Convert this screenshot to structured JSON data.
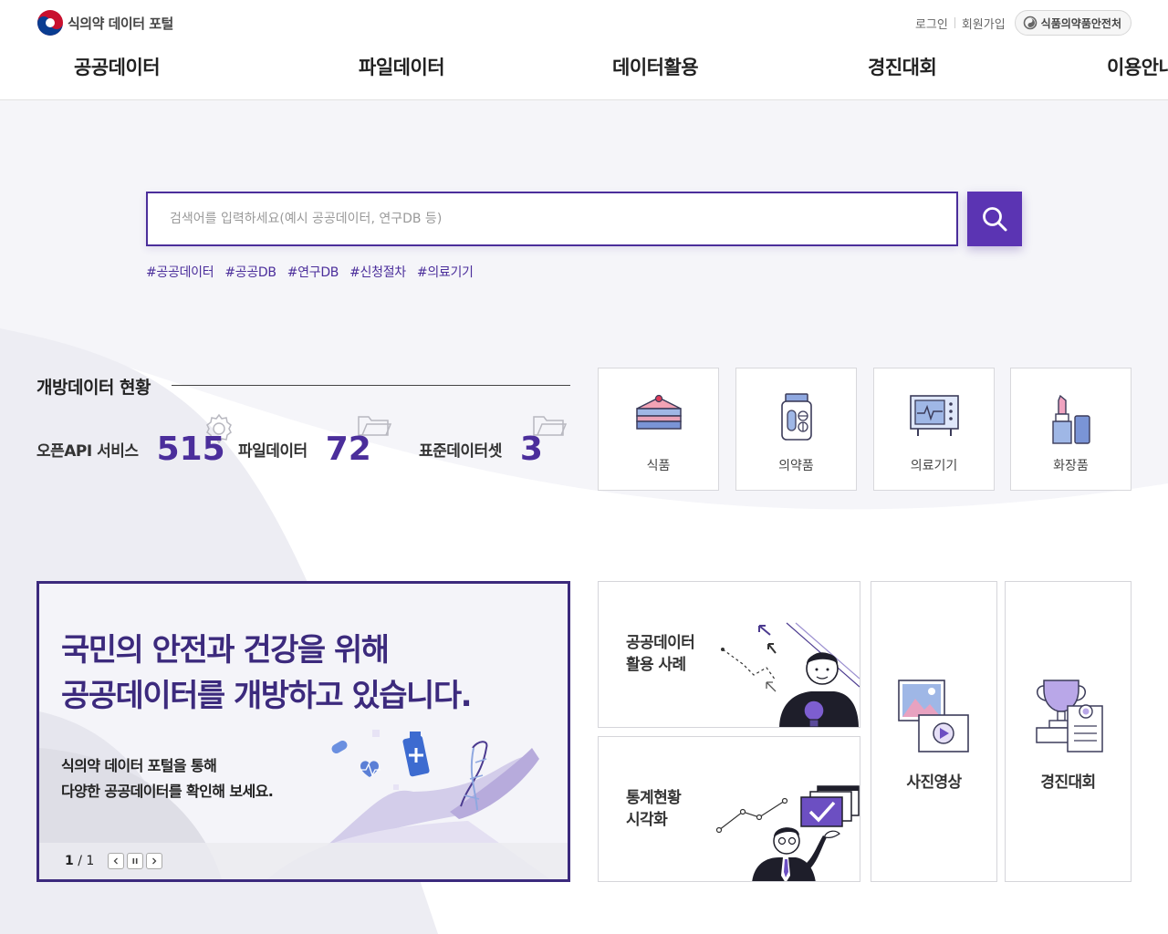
{
  "header": {
    "logo_text": "식의약 데이터 포털",
    "login": "로그인",
    "signup": "회원가입",
    "mfds": "식품의약품안전처",
    "nav": [
      "공공데이터",
      "파일데이터",
      "데이터활용",
      "경진대회",
      "이용안내"
    ]
  },
  "search": {
    "placeholder": "검색어를 입력하세요(예시 공공데이터, 연구DB 등)",
    "button_icon": "search-icon"
  },
  "tags": [
    "#공공데이터",
    "#공공DB",
    "#연구DB",
    "#신청절차",
    "#의료기기"
  ],
  "status": {
    "title": "개방데이터 현황",
    "items": [
      {
        "label": "오픈API 서비스",
        "value": "515",
        "icon": "gear-icon"
      },
      {
        "label": "파일데이터",
        "value": "72",
        "icon": "folder-icon"
      },
      {
        "label": "표준데이터셋",
        "value": "3",
        "icon": "folder-icon"
      }
    ]
  },
  "categories": [
    {
      "label": "식품",
      "icon": "cake-icon"
    },
    {
      "label": "의약품",
      "icon": "medicine-bottle-icon"
    },
    {
      "label": "의료기기",
      "icon": "monitor-device-icon"
    },
    {
      "label": "화장품",
      "icon": "cosmetics-icon"
    }
  ],
  "promo": {
    "headline_1": "국민의 안전과 건강을 위해",
    "headline_2": "공공데이터를 개방하고 있습니다.",
    "sub_1": "식의약 데이터 포털을 통해",
    "sub_2": "다양한 공공데이터를 확인해 보세요.",
    "page_current": "1",
    "page_sep": "/",
    "page_total": "1"
  },
  "menu_cards": {
    "usecase": {
      "line1": "공공데이터",
      "line2": "활용 사례"
    },
    "stats": {
      "line1": "통계현황",
      "line2": "시각화"
    },
    "photo": "사진영상",
    "contest": "경진대회"
  },
  "colors": {
    "accent": "#4b2e9b",
    "accent_dark": "#3c2a7d",
    "button": "#5b34b3"
  }
}
